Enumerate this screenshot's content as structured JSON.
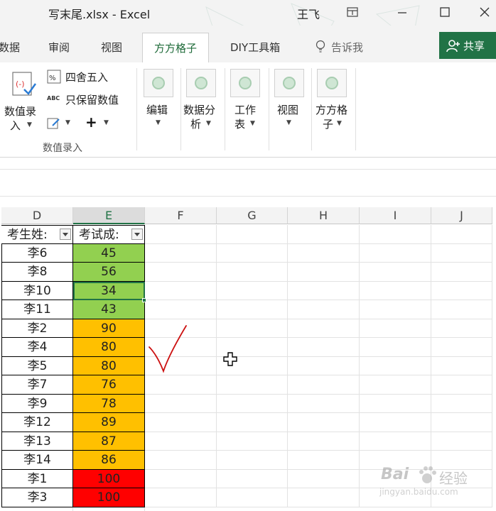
{
  "window": {
    "title": "写末尾.xlsx - Excel",
    "user": "王飞"
  },
  "tabs": {
    "data": "数据",
    "review": "审阅",
    "view": "视图",
    "fangfang": "方方格子",
    "diy": "DIY工具箱",
    "tell": "告诉我",
    "share": "共享"
  },
  "ribbon": {
    "value_entry_line1": "数值录",
    "value_entry_line2": "入",
    "round": "四舍五入",
    "keep_values": "只保留数值",
    "abc_icon": "ABC",
    "group_label": "数值录入",
    "edit": "编辑",
    "analysis_line1": "数据分",
    "analysis_line2": "析",
    "sheet_line1": "工作",
    "sheet_line2": "表",
    "view": "视图",
    "ffgz_line1": "方方格",
    "ffgz_line2": "子"
  },
  "columns": [
    "D",
    "E",
    "F",
    "G",
    "H",
    "I",
    "J"
  ],
  "table": {
    "header_name": "考生姓:",
    "header_score": "考试成:",
    "rows": [
      {
        "name": "李6",
        "score": "45",
        "color": "#92d050"
      },
      {
        "name": "李8",
        "score": "56",
        "color": "#92d050"
      },
      {
        "name": "李10",
        "score": "34",
        "color": "#92d050"
      },
      {
        "name": "李11",
        "score": "43",
        "color": "#92d050"
      },
      {
        "name": "李2",
        "score": "90",
        "color": "#ffc000"
      },
      {
        "name": "李4",
        "score": "80",
        "color": "#ffc000"
      },
      {
        "name": "李5",
        "score": "80",
        "color": "#ffc000"
      },
      {
        "name": "李7",
        "score": "76",
        "color": "#ffc000"
      },
      {
        "name": "李9",
        "score": "78",
        "color": "#ffc000"
      },
      {
        "name": "李12",
        "score": "89",
        "color": "#ffc000"
      },
      {
        "name": "李13",
        "score": "87",
        "color": "#ffc000"
      },
      {
        "name": "李14",
        "score": "86",
        "color": "#ffc000"
      },
      {
        "name": "李1",
        "score": "100",
        "color": "#ff0000"
      },
      {
        "name": "李3",
        "score": "100",
        "color": "#ff0000"
      }
    ]
  },
  "watermark": {
    "brand": "Bai",
    "brand2": "经验",
    "url": "jingyan.baidu.com"
  },
  "colors": {
    "accent": "#217346",
    "green_fill": "#92d050",
    "orange_fill": "#ffc000",
    "red_fill": "#ff0000",
    "checkmark": "#cc1111"
  }
}
